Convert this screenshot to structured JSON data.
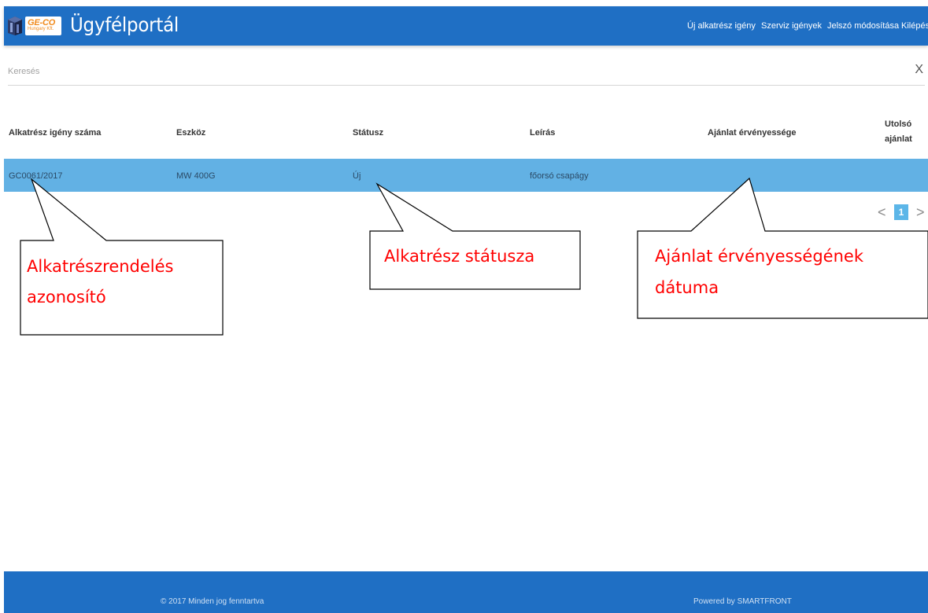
{
  "header": {
    "logo_main": "GE-CO",
    "logo_sub": "Hungary Kft.",
    "title": "Ügyfélportál",
    "nav": [
      {
        "label": "Új alkatrész igény"
      },
      {
        "label": "Szerviz igények"
      },
      {
        "label": "Jelszó módosítása"
      },
      {
        "label": "Kilépés"
      }
    ],
    "bar_color": "#1f6fc4"
  },
  "search": {
    "placeholder": "Keresés",
    "value": "",
    "clear_label": "X"
  },
  "table": {
    "columns": [
      {
        "label": "Alkatrész igény száma"
      },
      {
        "label": "Eszköz"
      },
      {
        "label": "Státusz"
      },
      {
        "label": "Leírás"
      },
      {
        "label": "Ajánlat érvényessége"
      },
      {
        "label_line1": "Utolsó",
        "label_line2": "ajánlat"
      }
    ],
    "rows": [
      {
        "id": "GC0061/2017",
        "device": "MW 400G",
        "status": "Új",
        "description": "főorsó csapágy",
        "offer_validity": "",
        "last_offer": ""
      }
    ],
    "selected_row_color": "#62b1e4"
  },
  "pagination": {
    "prev": "<",
    "current_page": "1",
    "next": ">"
  },
  "callouts": [
    {
      "line1": "Alkatrészrendelés",
      "line2": "azonosító"
    },
    {
      "line1": "Alkatrész státusza"
    },
    {
      "line1": "Ajánlat érvényességének",
      "line2": "dátuma"
    }
  ],
  "footer": {
    "copyright": "© 2017 Minden jog fenntartva",
    "powered_by": "Powered by SMARTFRONT"
  }
}
